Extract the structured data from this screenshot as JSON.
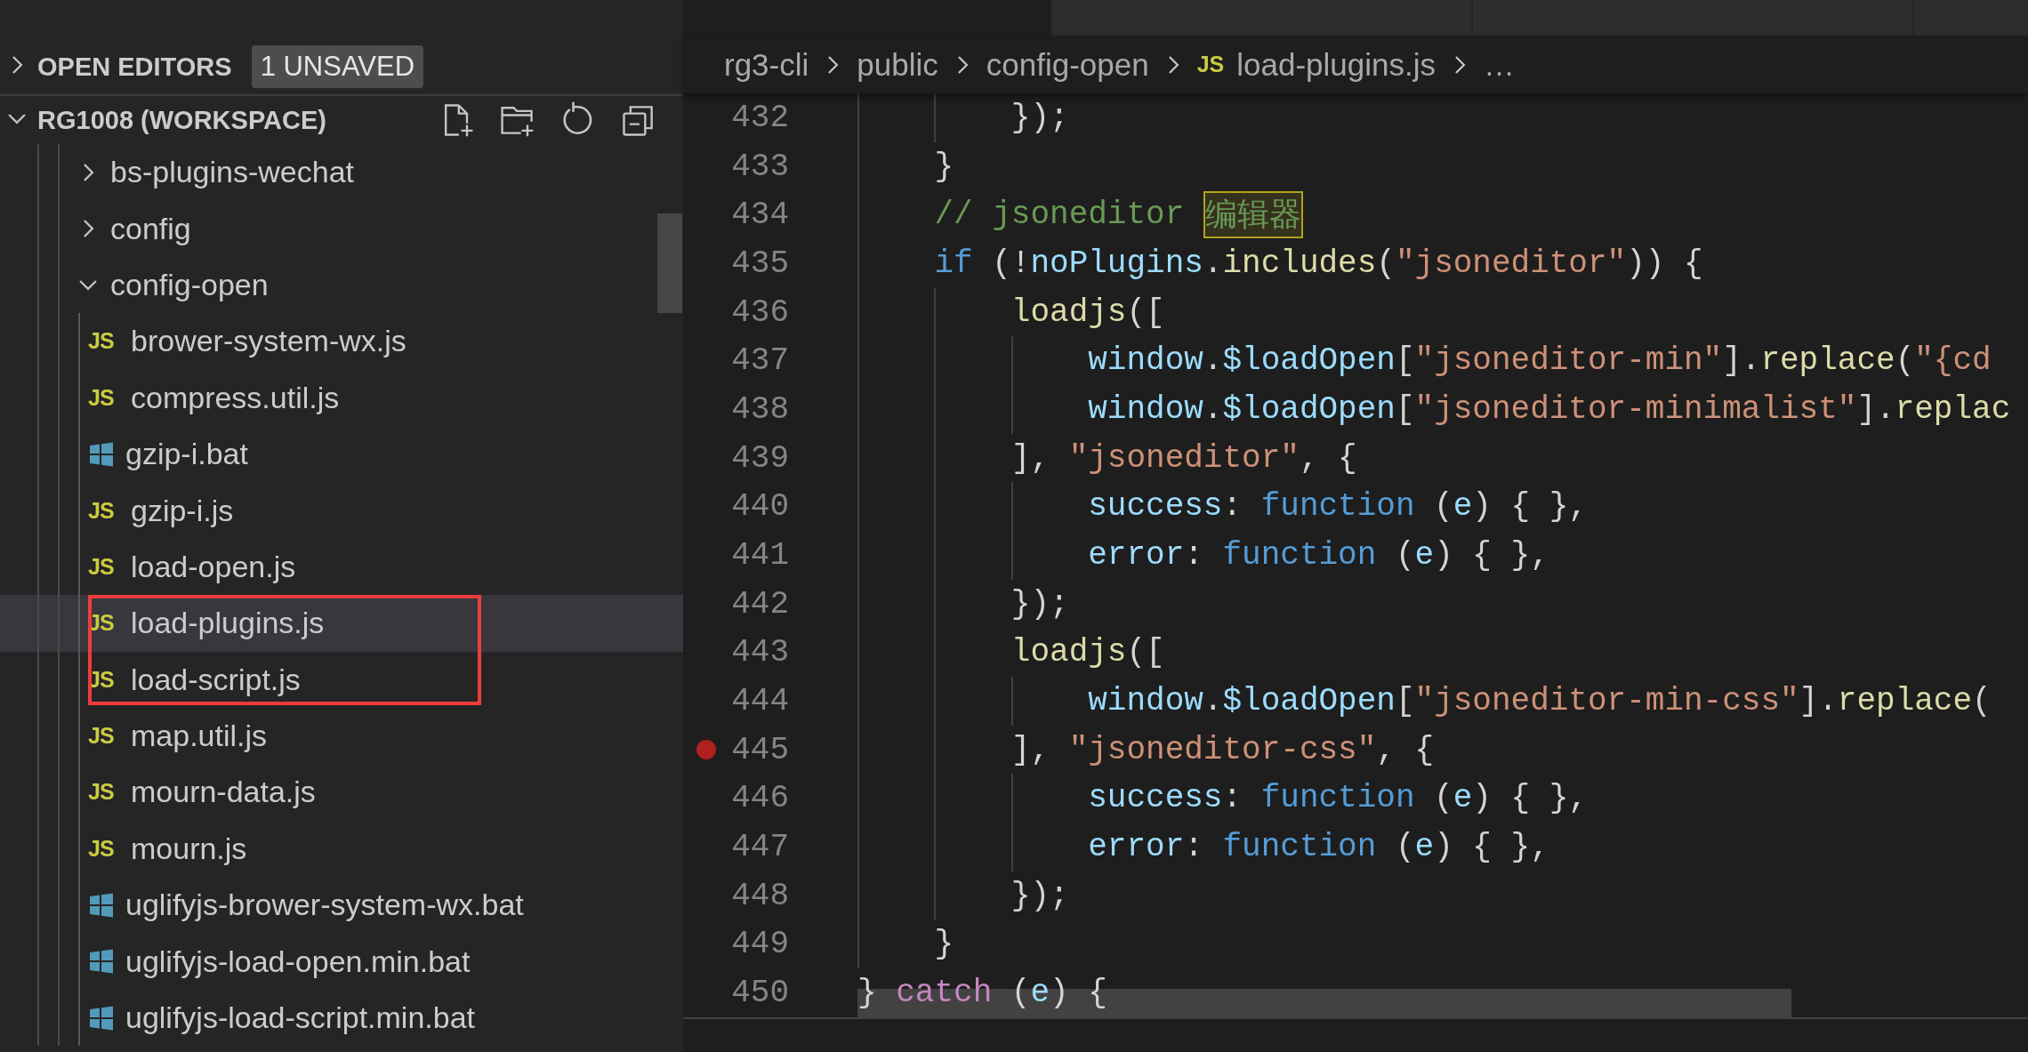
{
  "sidebar": {
    "open_editors": {
      "label": "OPEN EDITORS",
      "expanded": false,
      "badge": "1 UNSAVED"
    },
    "workspace": {
      "label": "RG1008 (WORKSPACE)",
      "expanded": true,
      "items": [
        {
          "name": "bs-plugins-wechat",
          "kind": "folder",
          "expanded": false,
          "selected": false
        },
        {
          "name": "config",
          "kind": "folder",
          "expanded": false,
          "selected": false
        },
        {
          "name": "config-open",
          "kind": "folder",
          "expanded": true,
          "selected": false,
          "children": [
            {
              "name": "brower-system-wx.js",
              "kind": "js",
              "icon_text": "JS",
              "selected": false
            },
            {
              "name": "compress.util.js",
              "kind": "js",
              "icon_text": "JS",
              "selected": false
            },
            {
              "name": "gzip-i.bat",
              "kind": "bat",
              "selected": false
            },
            {
              "name": "gzip-i.js",
              "kind": "js",
              "icon_text": "JS",
              "selected": false
            },
            {
              "name": "load-open.js",
              "kind": "js",
              "icon_text": "JS",
              "selected": false
            },
            {
              "name": "load-plugins.js",
              "kind": "js",
              "icon_text": "JS",
              "selected": true
            },
            {
              "name": "load-script.js",
              "kind": "js",
              "icon_text": "JS",
              "selected": false
            },
            {
              "name": "map.util.js",
              "kind": "js",
              "icon_text": "JS",
              "selected": false
            },
            {
              "name": "mourn-data.js",
              "kind": "js",
              "icon_text": "JS",
              "selected": false
            },
            {
              "name": "mourn.js",
              "kind": "js",
              "icon_text": "JS",
              "selected": false
            },
            {
              "name": "uglifyjs-brower-system-wx.bat",
              "kind": "bat",
              "selected": false
            },
            {
              "name": "uglifyjs-load-open.min.bat",
              "kind": "bat",
              "selected": false
            },
            {
              "name": "uglifyjs-load-script.min.bat",
              "kind": "bat",
              "selected": false
            }
          ]
        }
      ]
    }
  },
  "tabs": [
    {
      "selected": true
    },
    {
      "selected": false
    },
    {
      "selected": false
    },
    {
      "selected": false
    }
  ],
  "breadcrumbs": [
    {
      "label": "rg3-cli"
    },
    {
      "label": "public"
    },
    {
      "label": "config-open"
    },
    {
      "label": "load-plugins.js",
      "icon_text": "JS"
    },
    {
      "label": "…"
    }
  ],
  "code": [
    {
      "number": "432",
      "breakpoint": false,
      "tokens": [
        {
          "text": "        });",
          "kind": "plain"
        }
      ]
    },
    {
      "number": "433",
      "breakpoint": false,
      "tokens": [
        {
          "text": "    }",
          "kind": "plain"
        }
      ]
    },
    {
      "number": "434",
      "breakpoint": false,
      "tokens": [
        {
          "text": "    // jsoneditor ",
          "kind": "comment"
        },
        {
          "text": "编辑器",
          "kind": "highlight"
        }
      ]
    },
    {
      "number": "435",
      "breakpoint": false,
      "tokens": [
        {
          "text": "    if",
          "kind": "keyword"
        },
        {
          "text": " (!",
          "kind": "plain"
        },
        {
          "text": "noPlugins",
          "kind": "var"
        },
        {
          "text": ".",
          "kind": "plain"
        },
        {
          "text": "includes",
          "kind": "func"
        },
        {
          "text": "(",
          "kind": "plain"
        },
        {
          "text": "\"jsoneditor\"",
          "kind": "string"
        },
        {
          "text": ")) {",
          "kind": "plain"
        }
      ]
    },
    {
      "number": "436",
      "breakpoint": false,
      "tokens": [
        {
          "text": "        loadjs",
          "kind": "func"
        },
        {
          "text": "([",
          "kind": "plain"
        }
      ]
    },
    {
      "number": "437",
      "breakpoint": false,
      "tokens": [
        {
          "text": "            window",
          "kind": "var"
        },
        {
          "text": ".",
          "kind": "plain"
        },
        {
          "text": "$loadOpen",
          "kind": "var"
        },
        {
          "text": "[",
          "kind": "plain"
        },
        {
          "text": "\"jsoneditor-min\"",
          "kind": "string"
        },
        {
          "text": "].",
          "kind": "plain"
        },
        {
          "text": "replace",
          "kind": "func"
        },
        {
          "text": "(",
          "kind": "plain"
        },
        {
          "text": "\"{cd",
          "kind": "string"
        }
      ]
    },
    {
      "number": "438",
      "breakpoint": false,
      "tokens": [
        {
          "text": "            window",
          "kind": "var"
        },
        {
          "text": ".",
          "kind": "plain"
        },
        {
          "text": "$loadOpen",
          "kind": "var"
        },
        {
          "text": "[",
          "kind": "plain"
        },
        {
          "text": "\"jsoneditor-minimalist\"",
          "kind": "string"
        },
        {
          "text": "].",
          "kind": "plain"
        },
        {
          "text": "replac",
          "kind": "func"
        }
      ]
    },
    {
      "number": "439",
      "breakpoint": false,
      "tokens": [
        {
          "text": "        ], ",
          "kind": "plain"
        },
        {
          "text": "\"jsoneditor\"",
          "kind": "string"
        },
        {
          "text": ", {",
          "kind": "plain"
        }
      ]
    },
    {
      "number": "440",
      "breakpoint": false,
      "tokens": [
        {
          "text": "            success",
          "kind": "var"
        },
        {
          "text": ": ",
          "kind": "plain"
        },
        {
          "text": "function",
          "kind": "keyword"
        },
        {
          "text": " (",
          "kind": "plain"
        },
        {
          "text": "e",
          "kind": "var"
        },
        {
          "text": ") { },",
          "kind": "plain"
        }
      ]
    },
    {
      "number": "441",
      "breakpoint": false,
      "tokens": [
        {
          "text": "            error",
          "kind": "var"
        },
        {
          "text": ": ",
          "kind": "plain"
        },
        {
          "text": "function",
          "kind": "keyword"
        },
        {
          "text": " (",
          "kind": "plain"
        },
        {
          "text": "e",
          "kind": "var"
        },
        {
          "text": ") { },",
          "kind": "plain"
        }
      ]
    },
    {
      "number": "442",
      "breakpoint": false,
      "tokens": [
        {
          "text": "        });",
          "kind": "plain"
        }
      ]
    },
    {
      "number": "443",
      "breakpoint": false,
      "tokens": [
        {
          "text": "        loadjs",
          "kind": "func"
        },
        {
          "text": "([",
          "kind": "plain"
        }
      ]
    },
    {
      "number": "444",
      "breakpoint": false,
      "tokens": [
        {
          "text": "            window",
          "kind": "var"
        },
        {
          "text": ".",
          "kind": "plain"
        },
        {
          "text": "$loadOpen",
          "kind": "var"
        },
        {
          "text": "[",
          "kind": "plain"
        },
        {
          "text": "\"jsoneditor-min-css\"",
          "kind": "string"
        },
        {
          "text": "].",
          "kind": "plain"
        },
        {
          "text": "replace",
          "kind": "func"
        },
        {
          "text": "(",
          "kind": "plain"
        }
      ]
    },
    {
      "number": "445",
      "breakpoint": true,
      "tokens": [
        {
          "text": "        ], ",
          "kind": "plain"
        },
        {
          "text": "\"jsoneditor-css\"",
          "kind": "string"
        },
        {
          "text": ", {",
          "kind": "plain"
        }
      ]
    },
    {
      "number": "446",
      "breakpoint": false,
      "tokens": [
        {
          "text": "            success",
          "kind": "var"
        },
        {
          "text": ": ",
          "kind": "plain"
        },
        {
          "text": "function",
          "kind": "keyword"
        },
        {
          "text": " (",
          "kind": "plain"
        },
        {
          "text": "e",
          "kind": "var"
        },
        {
          "text": ") { },",
          "kind": "plain"
        }
      ]
    },
    {
      "number": "447",
      "breakpoint": false,
      "tokens": [
        {
          "text": "            error",
          "kind": "var"
        },
        {
          "text": ": ",
          "kind": "plain"
        },
        {
          "text": "function",
          "kind": "keyword"
        },
        {
          "text": " (",
          "kind": "plain"
        },
        {
          "text": "e",
          "kind": "var"
        },
        {
          "text": ") { },",
          "kind": "plain"
        }
      ]
    },
    {
      "number": "448",
      "breakpoint": false,
      "tokens": [
        {
          "text": "        });",
          "kind": "plain"
        }
      ]
    },
    {
      "number": "449",
      "breakpoint": false,
      "tokens": [
        {
          "text": "    }",
          "kind": "plain"
        }
      ]
    },
    {
      "number": "450",
      "breakpoint": false,
      "tokens": [
        {
          "text": "} ",
          "kind": "plain"
        },
        {
          "text": "catch",
          "kind": "control"
        },
        {
          "text": " (",
          "kind": "plain"
        },
        {
          "text": "e",
          "kind": "var"
        },
        {
          "text": ") {",
          "kind": "plain"
        }
      ]
    }
  ]
}
